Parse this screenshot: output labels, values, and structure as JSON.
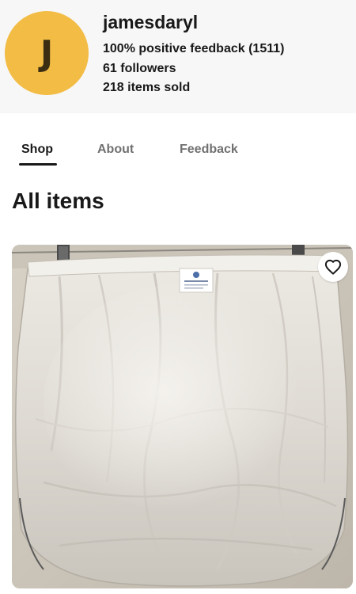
{
  "seller": {
    "avatar_letter": "J",
    "name": "jamesdaryl",
    "feedback": "100% positive feedback (1511)",
    "followers": "61 followers",
    "items_sold": "218 items sold"
  },
  "tabs": [
    {
      "label": "Shop",
      "active": true
    },
    {
      "label": "About",
      "active": false
    },
    {
      "label": "Feedback",
      "active": false
    }
  ],
  "main": {
    "section_title": "All items",
    "items": [
      {
        "image_icon": "product-photo",
        "favorite_icon": "heart-outline-icon"
      }
    ]
  },
  "colors": {
    "avatar_bg": "#f2bc45",
    "header_bg": "#f7f7f7",
    "text_primary": "#191919",
    "text_muted": "#707070"
  }
}
